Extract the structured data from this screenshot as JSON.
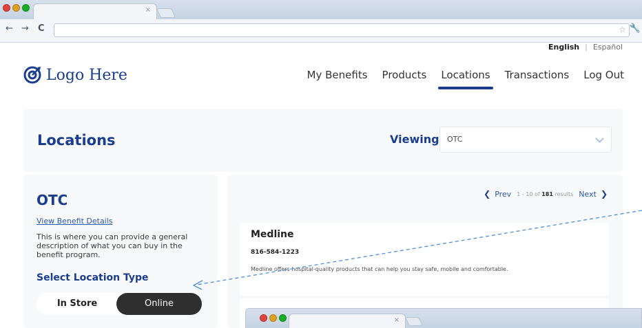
{
  "browser": {
    "tab_close": "×",
    "back": "←",
    "forward": "→",
    "reload": "C"
  },
  "language": {
    "english": "English",
    "separator": "|",
    "spanish": "Español"
  },
  "logo": {
    "text": "Logo Here"
  },
  "nav": {
    "items": [
      "My Benefits",
      "Products",
      "Locations",
      "Transactions",
      "Log Out"
    ],
    "active": "Locations"
  },
  "page": {
    "title": "Locations",
    "viewing_label": "Viewing",
    "viewing_value": "OTC"
  },
  "benefit": {
    "title": "OTC",
    "link": "View Benefit Details",
    "description": "This is where you can provide a general description of what you can buy in the benefit program.",
    "select_title": "Select Location Type",
    "options": [
      "In Store",
      "Online"
    ],
    "selected": "Online"
  },
  "pagination": {
    "prev": "Prev",
    "range": "1 - 10 of",
    "total": "181",
    "results_word": "results",
    "next": "Next"
  },
  "results": [
    {
      "name": "Medline",
      "phone": "816-584-1223",
      "description": "Medline offers hospital-quality products that can help you stay safe, mobile and comfortable."
    }
  ],
  "colors": {
    "brand": "#1a3d8f",
    "link": "#2d57a8",
    "annotation": "#4a90d9",
    "toggle_active": "#2f2f2f",
    "panel_bg": "#f7f9fb"
  },
  "icons": {
    "logo": "target-icon",
    "star": "star-icon",
    "wrench": "wrench-icon",
    "viewing_select": "chevron-down-icon",
    "pager_prev": "chevron-left-icon",
    "pager_next": "chevron-right-icon"
  }
}
